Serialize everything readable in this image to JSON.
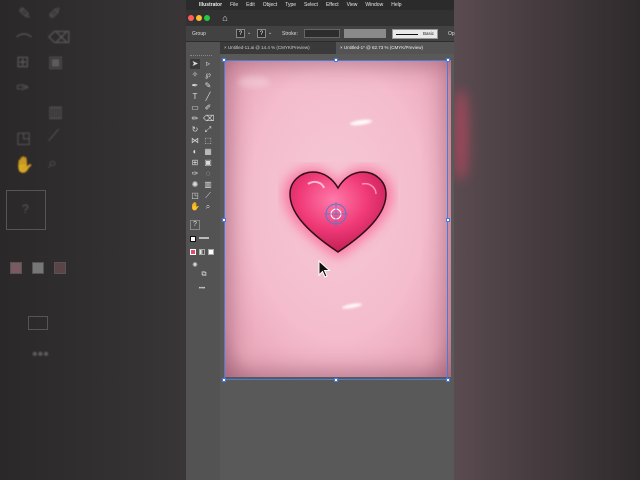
{
  "menubar": {
    "app_name": "Illustrator",
    "items": [
      "File",
      "Edit",
      "Object",
      "Type",
      "Select",
      "Effect",
      "View",
      "Window",
      "Help"
    ]
  },
  "controlbar": {
    "selection_label": "Group",
    "stroke_label": "Stroke:",
    "style_label": "Basic",
    "opacity_label": "Op"
  },
  "tabs": [
    {
      "label": "Untitled-11.ai @ 14.4 % (CMYK/Preview)",
      "active": false
    },
    {
      "label": "Untitled-1* @ 62.73 % (CMYK/Preview)",
      "active": true
    }
  ],
  "toolbar": {
    "help_glyph": "?"
  },
  "colors": {
    "accent": "#4a7bd8",
    "heart": "#f03a78",
    "artboard": "#f4bccd",
    "close": "#ff5f57",
    "minimize": "#febc2e",
    "zoom": "#28c840"
  }
}
